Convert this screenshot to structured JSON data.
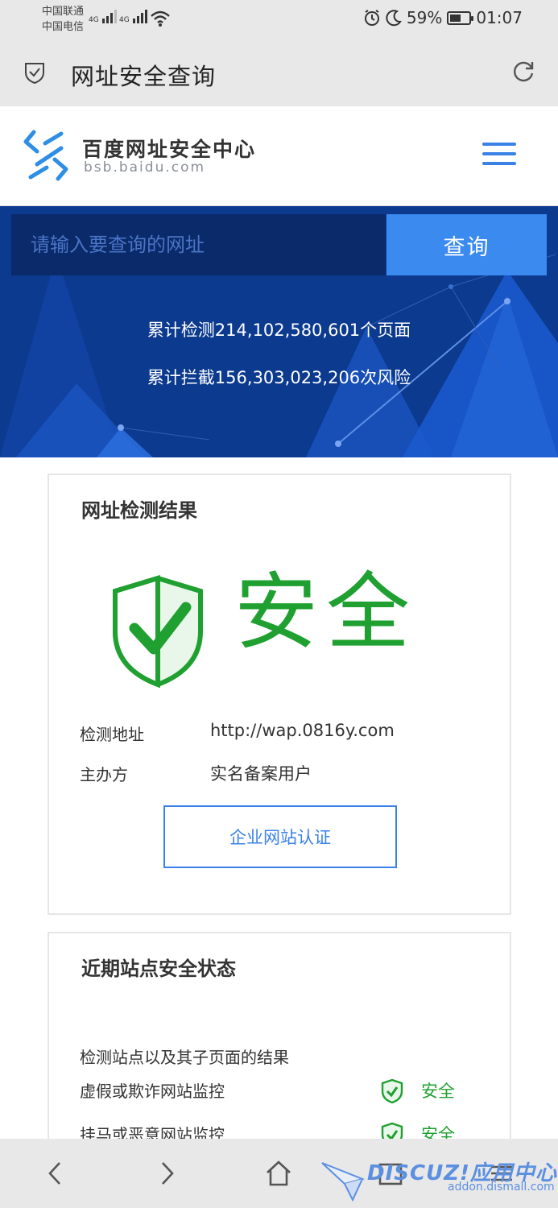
{
  "status_bar": {
    "carrier_1": "中国联通",
    "carrier_2": "中国电信",
    "network_1": "4G",
    "network_2": "4G",
    "battery": "59%",
    "battery_level": 0.59,
    "time": "01:07"
  },
  "browser": {
    "title": "网址安全查询"
  },
  "site": {
    "name_cn": "百度网址安全中心",
    "name_en": "bsb.baidu.com"
  },
  "search": {
    "placeholder": "请输入要查询的网址",
    "button": "查询"
  },
  "stats": {
    "pages_checked": "累计检测214,102,580,601个页面",
    "risks_blocked": "累计拦截156,303,023,206次风险"
  },
  "result": {
    "title": "网址检测结果",
    "verdict": "安全",
    "address_label": "检测地址",
    "address_value": "http://wap.0816y.com",
    "owner_label": "主办方",
    "owner_value": "实名备案用户",
    "cert_button": "企业网站认证"
  },
  "recent": {
    "title": "近期站点安全状态",
    "description": "检测站点以及其子页面的结果",
    "items": [
      {
        "label": "虚假或欺诈网站监控",
        "status": "安全"
      },
      {
        "label": "挂马或恶意网站监控",
        "status": "安全"
      }
    ]
  },
  "watermark": {
    "brand": "DISCUZ!应用中心",
    "domain": "addon.dismall.com"
  },
  "colors": {
    "accent_blue": "#3a8af0",
    "hero_blue": "#0b3a8f",
    "safe_green": "#1fa030"
  }
}
